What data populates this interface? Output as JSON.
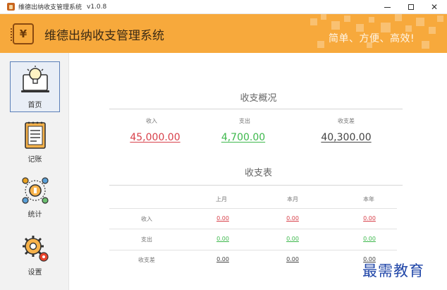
{
  "window": {
    "title": "维德出纳收支管理系统",
    "version": "v1.0.8"
  },
  "header": {
    "app_name": "维德出纳收支管理系统",
    "logo_symbol": "¥",
    "slogan": "简单、方便、高效!",
    "background_color": "#f7a93c"
  },
  "sidebar": {
    "items": [
      {
        "label": "首页",
        "icon": "lightbulb-laptop-icon",
        "active": true
      },
      {
        "label": "记账",
        "icon": "ledger-book-icon",
        "active": false
      },
      {
        "label": "统计",
        "icon": "stats-cycle-icon",
        "active": false
      },
      {
        "label": "设置",
        "icon": "gears-icon",
        "active": false
      }
    ]
  },
  "overview": {
    "title": "收支概况",
    "items": [
      {
        "label": "收入",
        "value": "45,000.00",
        "color": "#d8404a"
      },
      {
        "label": "支出",
        "value": "4,700.00",
        "color": "#3db84c"
      },
      {
        "label": "收支差",
        "value": "40,300.00",
        "color": "#444444"
      }
    ]
  },
  "table": {
    "title": "收支表",
    "columns": [
      "上月",
      "本月",
      "本年"
    ],
    "rows": [
      {
        "label": "收入",
        "values": [
          "0.00",
          "0.00",
          "0.00"
        ]
      },
      {
        "label": "支出",
        "values": [
          "0.00",
          "0.00",
          "0.00"
        ]
      },
      {
        "label": "收支差",
        "values": [
          "0.00",
          "0.00",
          "0.00"
        ]
      }
    ]
  },
  "watermark": "最需教育"
}
